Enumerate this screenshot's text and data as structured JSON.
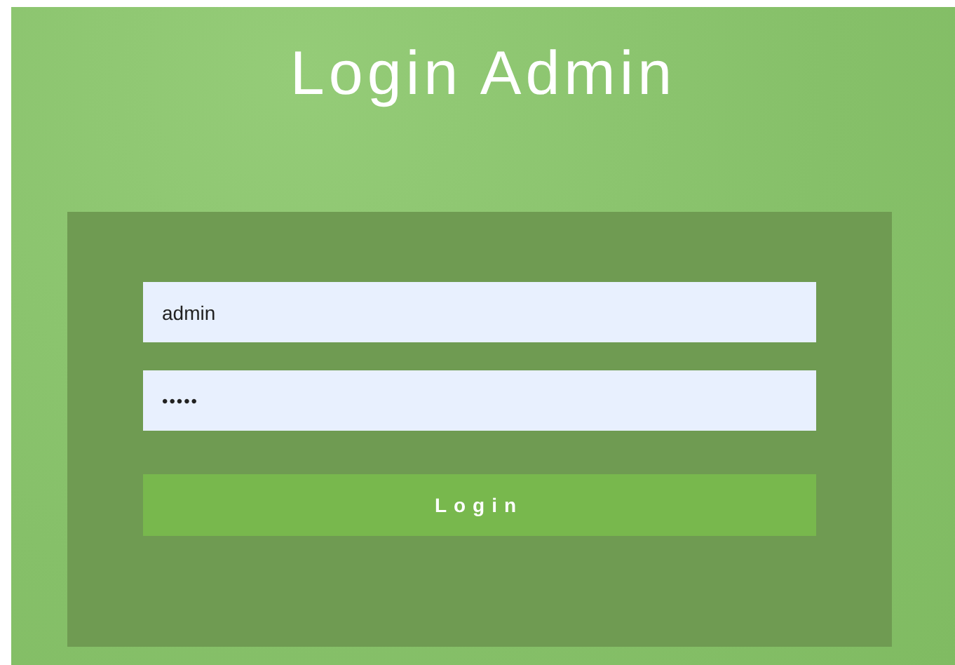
{
  "title": "Login Admin",
  "fields": [
    {
      "kind": "username",
      "value": "admin"
    },
    {
      "kind": "password",
      "value": "•••••"
    }
  ],
  "button": "Login"
}
